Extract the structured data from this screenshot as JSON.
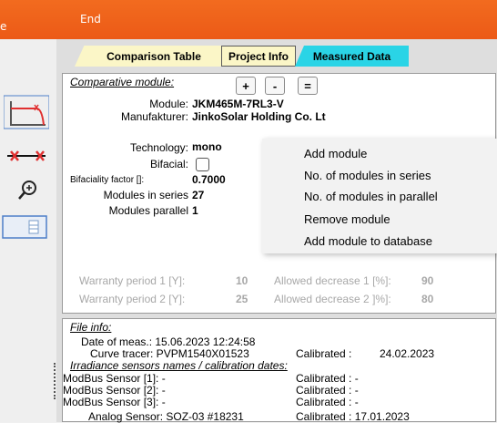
{
  "topbar": {
    "left_fragment": "e",
    "end_label": "End"
  },
  "tabs": [
    {
      "label": "Comparison Table"
    },
    {
      "label": "Project Info"
    },
    {
      "label": "Measured Data"
    }
  ],
  "comparative": {
    "heading": "Comparative module:",
    "buttons": [
      "+",
      "-",
      "="
    ],
    "module_label": "Module:",
    "module_value": "JKM465M-7RL3-V",
    "manufacturer_label": "Manufakturer:",
    "manufacturer_value": "JinkoSolar Holding Co. Lt",
    "technology_label": "Technology:",
    "technology_value": "mono",
    "bifacial_label": "Bifacial:",
    "bifaciality_label": "Bifaciality factor []:",
    "bifaciality_value": "0.7000",
    "series_label": "Modules in series",
    "series_value": "27",
    "parallel_label": "Modules parallel",
    "parallel_value": "1",
    "warranty1_label": "Warranty period 1 [Y]:",
    "warranty1_value": "10",
    "warranty2_label": "Warranty period 2 [Y]:",
    "warranty2_value": "25",
    "decrease1_label": "Allowed decrease 1 [%]:",
    "decrease1_value": "90",
    "decrease2_label": "Allowed decrease 2 ]%]:",
    "decrease2_value": "80"
  },
  "context_menu": [
    "Add module",
    "No. of modules in series",
    "No. of modules in parallel",
    "Remove module",
    "Add module to database"
  ],
  "file_info": {
    "heading": "File info:",
    "date_line": "Date of meas.: 15.06.2023  12:24:58",
    "tracer_line": "Curve tracer: PVPM1540X01523",
    "calibrated_label": "Calibrated :",
    "calibrated_value": "24.02.2023",
    "irradiance_heading": "Irradiance sensors names / calibration dates:",
    "sensors": [
      {
        "name": "ModBus Sensor [1]: -",
        "cal": "Calibrated :  -"
      },
      {
        "name": "ModBus Sensor [2]: -",
        "cal": "Calibrated :  -"
      },
      {
        "name": "ModBus Sensor [3]: -",
        "cal": "Calibrated :  -"
      }
    ],
    "analog_line": "Analog Sensor: SOZ-03 #18231",
    "analog_cal": "Calibrated :  17.01.2023"
  },
  "colors": {
    "topbar": "#ef631b",
    "tab_active": "#fbf6c7",
    "tab_measured": "#2ad4e6"
  }
}
